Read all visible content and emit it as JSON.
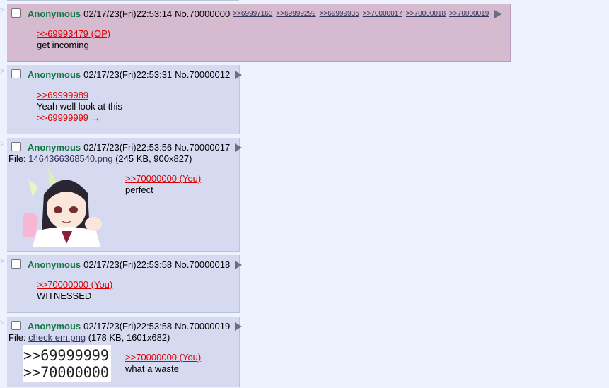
{
  "sidebar_arrow": ">",
  "posts": [
    {
      "name": "Anonymous",
      "date": "02/17/23(Fri)22:53:14",
      "number": "No.70000000",
      "backlinks": [
        ">>69997163",
        ">>69999292",
        ">>69999935",
        ">>70000017",
        ">>70000018",
        ">>70000019"
      ],
      "quote": ">>69993479 (OP)",
      "text": "get incoming"
    },
    {
      "name": "Anonymous",
      "date": "02/17/23(Fri)22:53:31",
      "number": "No.70000012",
      "quote": ">>69999989",
      "text": "Yeah well look at this",
      "quote2": ">>69999999 →"
    },
    {
      "name": "Anonymous",
      "date": "02/17/23(Fri)22:53:56",
      "number": "No.70000017",
      "file_label": "File: ",
      "file_name": "1464366368540.png",
      "file_info": " (245 KB, 900x827)",
      "quote": ">>70000000 (You)",
      "text": "perfect"
    },
    {
      "name": "Anonymous",
      "date": "02/17/23(Fri)22:53:58",
      "number": "No.70000018",
      "quote": ">>70000000 (You)",
      "text": "WITNESSED"
    },
    {
      "name": "Anonymous",
      "date": "02/17/23(Fri)22:53:58",
      "number": "No.70000019",
      "file_label": "File: ",
      "file_name": "check em.png",
      "file_info": " (178 KB, 1601x682)",
      "quote": ">>70000000 (You)",
      "text": "what a waste",
      "thumb_lines": [
        ">>69999999",
        ">>70000000"
      ]
    }
  ],
  "colors": {
    "background": "#eef2ff",
    "post_bg": "#d6daf0",
    "highlight_bg": "#d6bad0",
    "name": "#117743",
    "quote": "#dd0000",
    "link": "#34345c"
  }
}
